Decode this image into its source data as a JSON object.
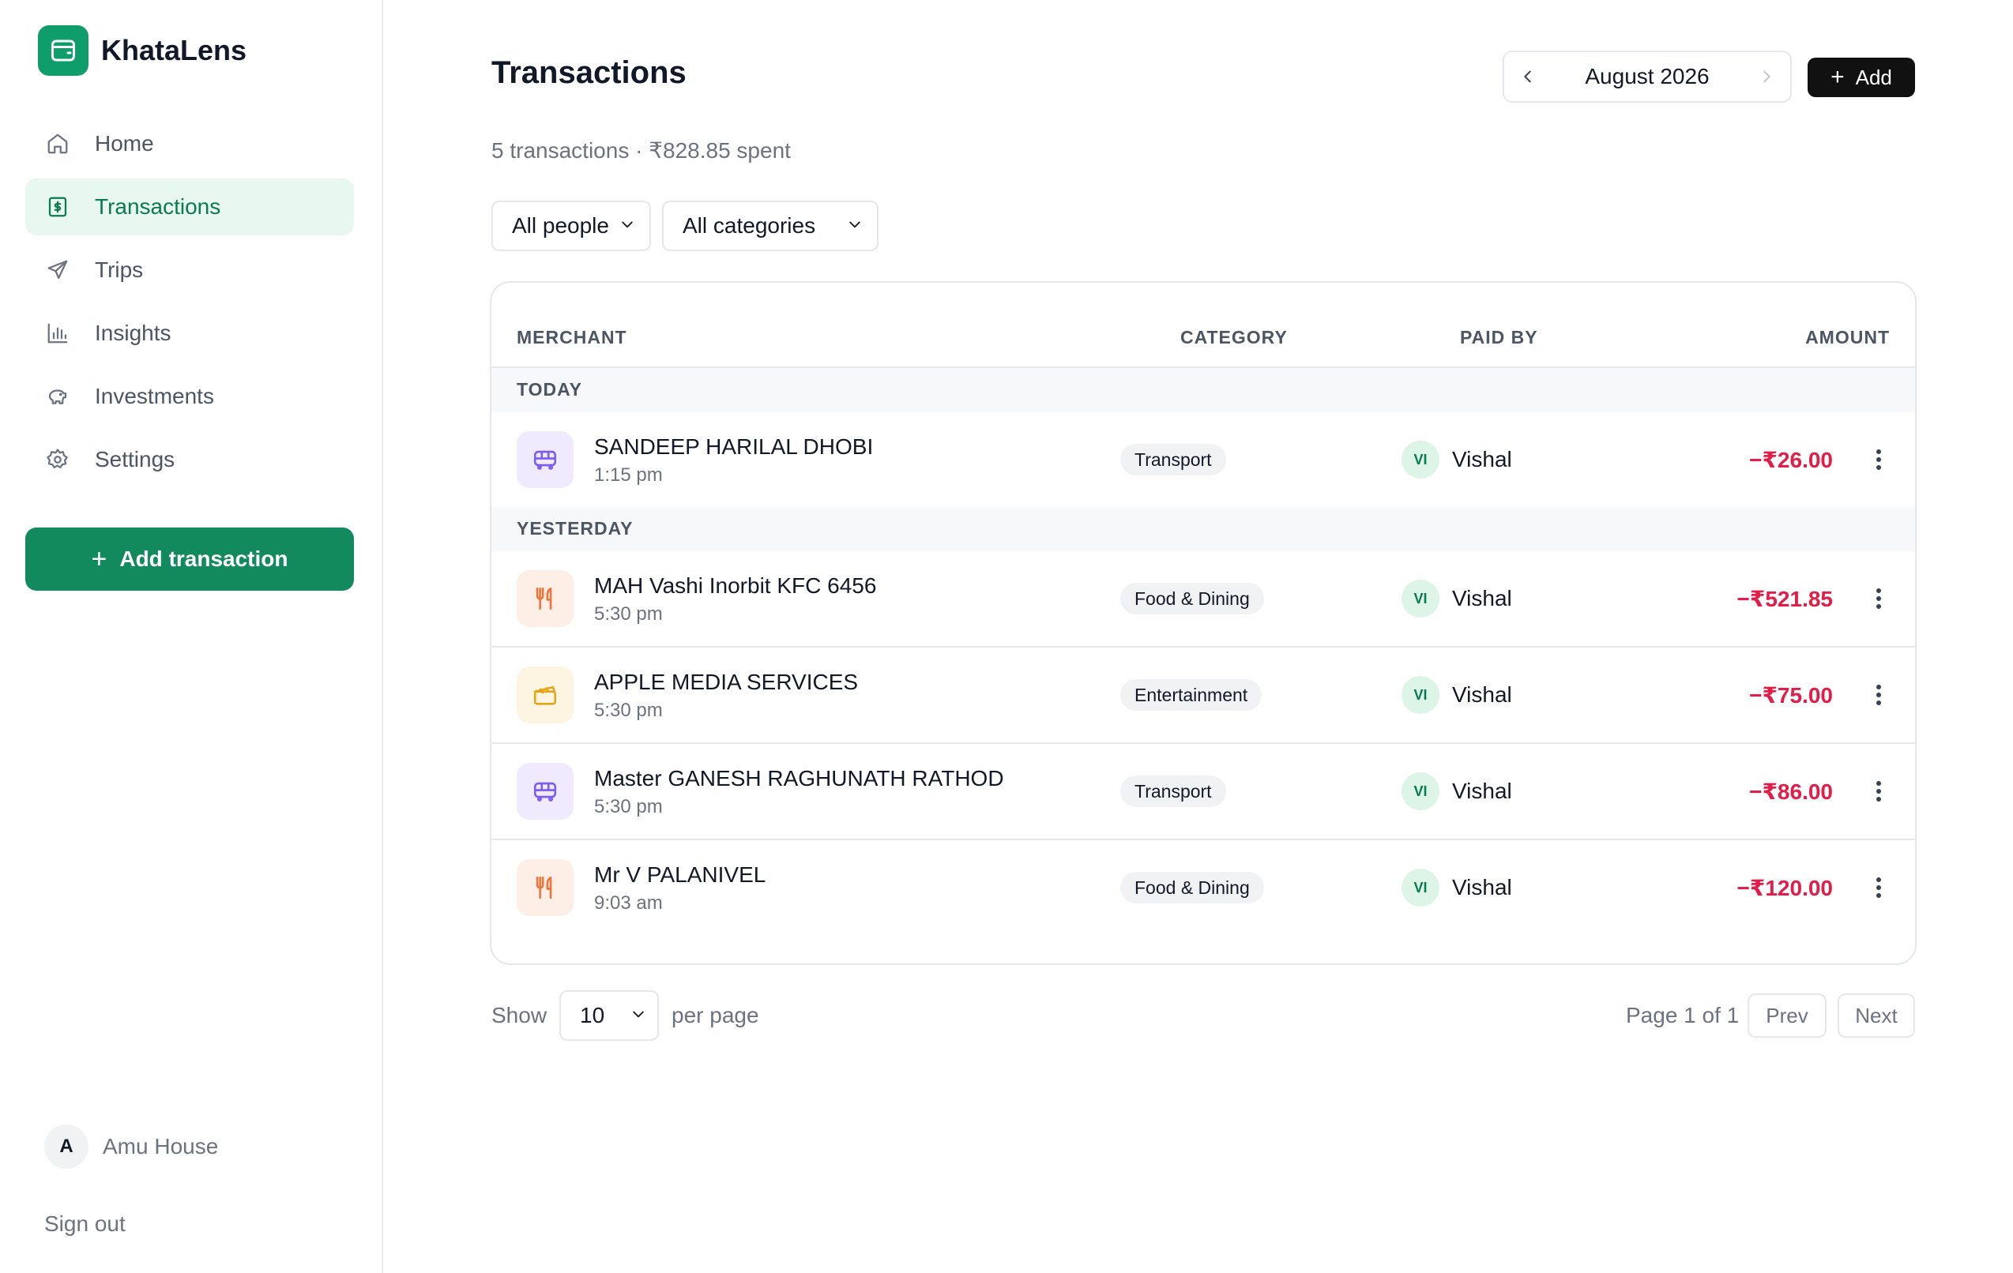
{
  "app": {
    "name": "KhataLens"
  },
  "sidebar": {
    "items": [
      {
        "label": "Home",
        "icon": "home-icon"
      },
      {
        "label": "Transactions",
        "icon": "receipt-icon",
        "active": true
      },
      {
        "label": "Trips",
        "icon": "plane-icon"
      },
      {
        "label": "Insights",
        "icon": "bar-chart-icon"
      },
      {
        "label": "Investments",
        "icon": "piggy-bank-icon"
      },
      {
        "label": "Settings",
        "icon": "gear-icon"
      }
    ],
    "add_label": "Add transaction",
    "user": {
      "initial": "A",
      "name": "Amu House"
    },
    "signout": "Sign out"
  },
  "header": {
    "title": "Transactions",
    "month": "August 2026",
    "add_label": "Add",
    "summary": "5 transactions · ₹828.85 spent"
  },
  "filters": {
    "people": "All people",
    "categories": "All categories"
  },
  "table": {
    "columns": {
      "merchant": "MERCHANT",
      "category": "CATEGORY",
      "paid_by": "PAID BY",
      "amount": "AMOUNT"
    },
    "groups": [
      {
        "label": "TODAY"
      },
      {
        "label": "YESTERDAY"
      }
    ],
    "rows": [
      {
        "merchant": "SANDEEP HARILAL DHOBI",
        "time": "1:15 pm",
        "category": "Transport",
        "payer_initials": "VI",
        "payer": "Vishal",
        "amount": "−₹26.00",
        "icon": "bus-icon"
      },
      {
        "merchant": "MAH Vashi Inorbit KFC 6456",
        "time": "5:30 pm",
        "category": "Food & Dining",
        "payer_initials": "VI",
        "payer": "Vishal",
        "amount": "−₹521.85",
        "icon": "fork-knife-icon"
      },
      {
        "merchant": "APPLE MEDIA SERVICES",
        "time": "5:30 pm",
        "category": "Entertainment",
        "payer_initials": "VI",
        "payer": "Vishal",
        "amount": "−₹75.00",
        "icon": "clapperboard-icon"
      },
      {
        "merchant": "Master GANESH RAGHUNATH RATHOD",
        "time": "5:30 pm",
        "category": "Transport",
        "payer_initials": "VI",
        "payer": "Vishal",
        "amount": "−₹86.00",
        "icon": "bus-icon"
      },
      {
        "merchant": "Mr V PALANIVEL",
        "time": "9:03 am",
        "category": "Food & Dining",
        "payer_initials": "VI",
        "payer": "Vishal",
        "amount": "−₹120.00",
        "icon": "fork-knife-icon"
      }
    ]
  },
  "pagination": {
    "show": "Show",
    "per_page_value": "10",
    "per_page": "per page",
    "page_info": "Page 1 of 1",
    "prev": "Prev",
    "next": "Next"
  },
  "colors": {
    "brand": "#0f9d6b",
    "active_bg": "#e8f7ef",
    "negative": "#e11d48",
    "transport_bg": "#efeafd",
    "food_bg": "#fdeee6",
    "entertainment_bg": "#fdf5e2"
  }
}
